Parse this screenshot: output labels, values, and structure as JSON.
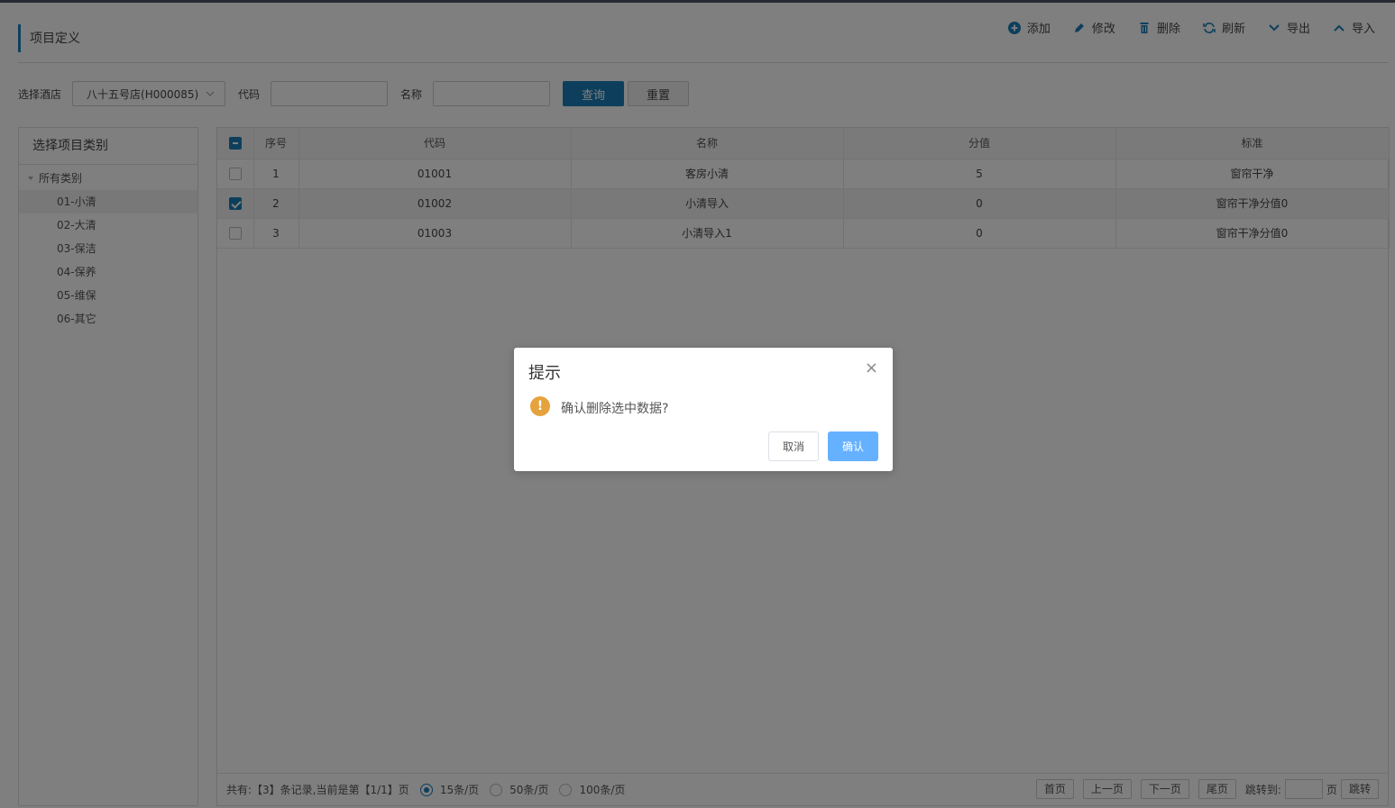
{
  "page": {
    "title": "项目定义"
  },
  "toolbar": {
    "add": "添加",
    "edit": "修改",
    "delete": "删除",
    "refresh": "刷新",
    "export": "导出",
    "import": "导入"
  },
  "filters": {
    "hotel_label": "选择酒店",
    "hotel_value": "八十五号店(H000085)",
    "code_label": "代码",
    "code_value": "",
    "name_label": "名称",
    "name_value": "",
    "query_button": "查询",
    "reset_button": "重置"
  },
  "category_panel": {
    "title": "选择项目类别",
    "root": "所有类别",
    "items": [
      {
        "label": "01-小清",
        "selected": true
      },
      {
        "label": "02-大清",
        "selected": false
      },
      {
        "label": "03-保洁",
        "selected": false
      },
      {
        "label": "04-保养",
        "selected": false
      },
      {
        "label": "05-维保",
        "selected": false
      },
      {
        "label": "06-其它",
        "selected": false
      }
    ]
  },
  "table": {
    "columns": [
      "序号",
      "代码",
      "名称",
      "分值",
      "标准"
    ],
    "rows": [
      {
        "seq": "1",
        "code": "01001",
        "name": "客房小清",
        "score": "5",
        "standard": "窗帘干净",
        "checked": false
      },
      {
        "seq": "2",
        "code": "01002",
        "name": "小清导入",
        "score": "0",
        "standard": "窗帘干净分值0",
        "checked": true
      },
      {
        "seq": "3",
        "code": "01003",
        "name": "小清导入1",
        "score": "0",
        "standard": "窗帘干净分值0",
        "checked": false
      }
    ]
  },
  "pager": {
    "summary": "共有:【3】条记录,当前是第【1/1】页",
    "size_options": [
      {
        "label": "15条/页",
        "selected": true
      },
      {
        "label": "50条/页",
        "selected": false
      },
      {
        "label": "100条/页",
        "selected": false
      }
    ],
    "first": "首页",
    "prev": "上一页",
    "next": "下一页",
    "last": "尾页",
    "jump_label": "跳转到:",
    "jump_value": "",
    "page_unit": "页",
    "jump_button": "跳转"
  },
  "dialog": {
    "title": "提示",
    "message": "确认删除选中数据?",
    "cancel": "取消",
    "confirm": "确认",
    "close_glyph": "×",
    "warn_glyph": "!"
  },
  "colors": {
    "primary": "#1a7fb8",
    "confirm": "#66b1ff",
    "warning": "#e6a23c"
  }
}
